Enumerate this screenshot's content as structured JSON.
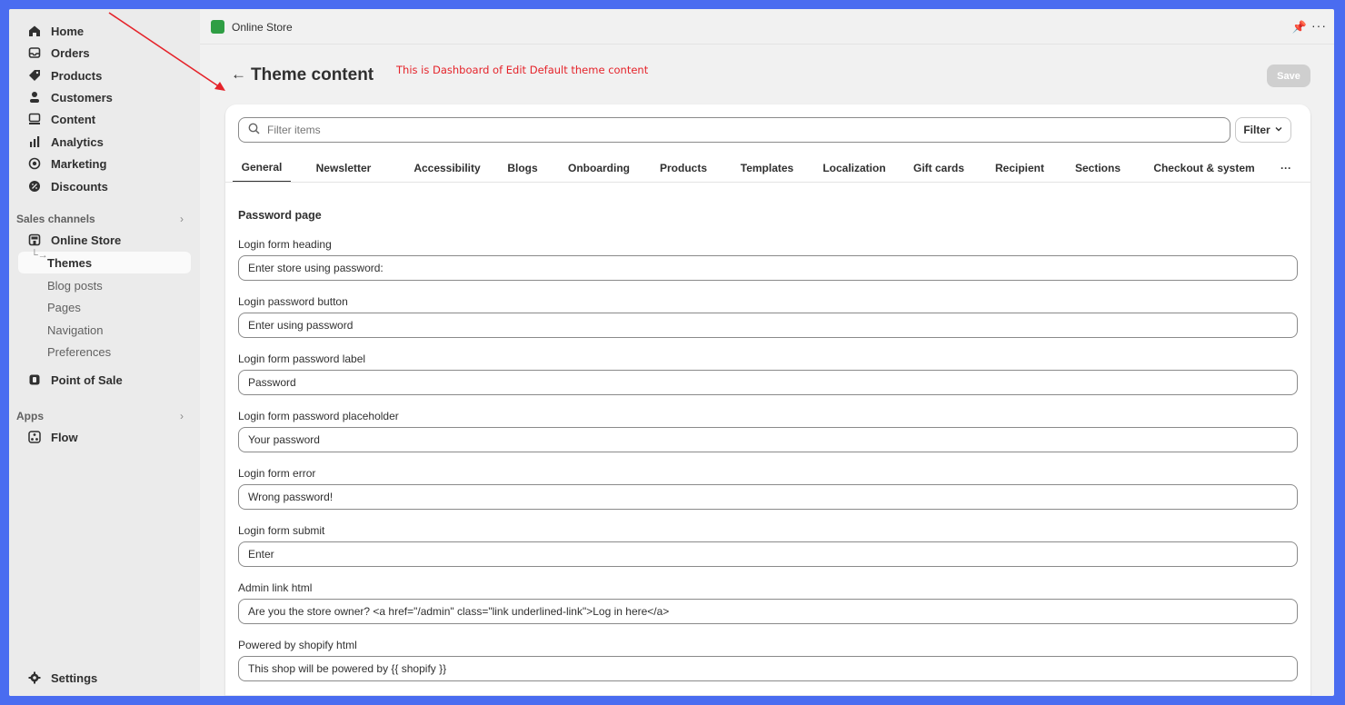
{
  "sidebar": {
    "items": [
      {
        "label": "Home",
        "icon": "home-icon"
      },
      {
        "label": "Orders",
        "icon": "orders-icon"
      },
      {
        "label": "Products",
        "icon": "tag-icon"
      },
      {
        "label": "Customers",
        "icon": "person-icon"
      },
      {
        "label": "Content",
        "icon": "content-icon"
      },
      {
        "label": "Analytics",
        "icon": "bar-chart-icon"
      },
      {
        "label": "Marketing",
        "icon": "target-icon"
      },
      {
        "label": "Discounts",
        "icon": "discount-icon"
      }
    ],
    "sales_channels_label": "Sales channels",
    "online_store": "Online Store",
    "online_store_sub": [
      "Themes",
      "Blog posts",
      "Pages",
      "Navigation",
      "Preferences"
    ],
    "point_of_sale": "Point of Sale",
    "apps_label": "Apps",
    "flow": "Flow",
    "settings": "Settings"
  },
  "topbar": {
    "title": "Online Store",
    "pin_glyph": "📌",
    "more_glyph": "···"
  },
  "header": {
    "title": "Theme content",
    "annotation": "This is Dashboard of Edit Default theme content",
    "save_label": "Save"
  },
  "filter": {
    "placeholder": "Filter items",
    "button_label": "Filter"
  },
  "tabs": [
    "General",
    "Newsletter",
    "Accessibility",
    "Blogs",
    "Onboarding",
    "Products",
    "Templates",
    "Localization",
    "Gift cards",
    "Recipient",
    "Sections",
    "Checkout & system",
    "···"
  ],
  "form": {
    "section_title": "Password page",
    "fields": [
      {
        "label": "Login form heading",
        "value": "Enter store using password:"
      },
      {
        "label": "Login password button",
        "value": "Enter using password"
      },
      {
        "label": "Login form password label",
        "value": "Password"
      },
      {
        "label": "Login form password placeholder",
        "value": "Your password"
      },
      {
        "label": "Login form error",
        "value": "Wrong password!"
      },
      {
        "label": "Login form submit",
        "value": "Enter"
      },
      {
        "label": "Admin link html",
        "value": "Are you the store owner? <a href=\"/admin\" class=\"link underlined-link\">Log in here</a>"
      },
      {
        "label": "Powered by shopify html",
        "value": "This shop will be powered by {{ shopify }}"
      }
    ]
  },
  "colors": {
    "frame_border": "#4a6cf0",
    "annotation": "#e5232a",
    "brand_green": "#2f9e44"
  }
}
